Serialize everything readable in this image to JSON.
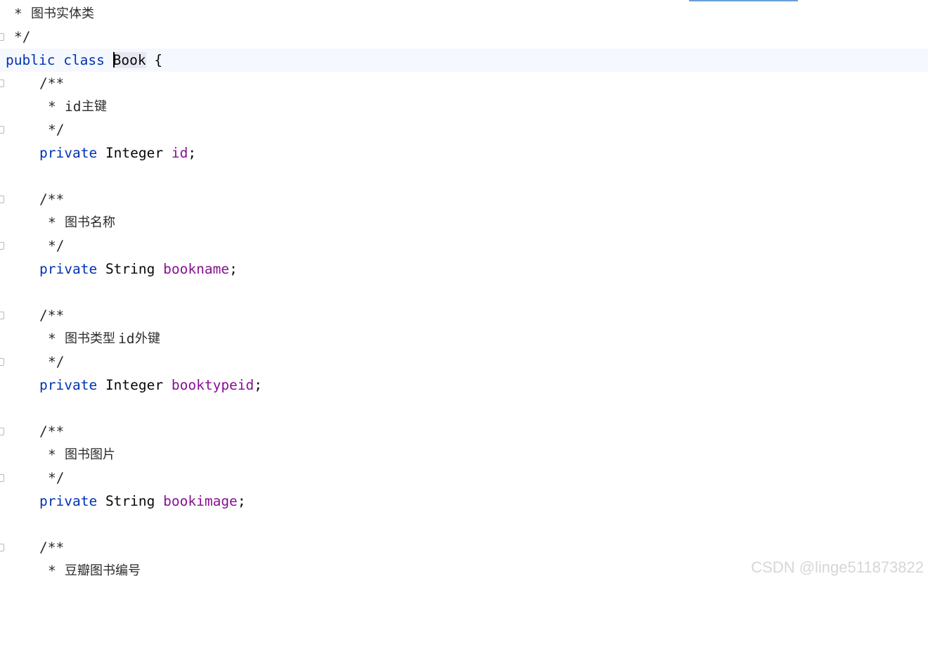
{
  "editor": {
    "language": "Java",
    "colors": {
      "keyword": "#0033b3",
      "field": "#871094",
      "text": "#080808",
      "current_line": "#f5f8fe",
      "watermark": "#c8c8c8"
    },
    "lines": {
      "l1_star": "* ",
      "l1_text": "图书实体类",
      "l2": "*/",
      "l3_kw1": "public",
      "l3_kw2": "class",
      "l3_name": "Book",
      "l3_brace": " {",
      "c_open": "/**",
      "c_close": "*/",
      "c1_id": "id",
      "c1_text": "主键",
      "f1_kw": "private",
      "f1_type": "Integer",
      "f1_name": "id",
      "c2_text": "图书名称",
      "f2_kw": "private",
      "f2_type": "String",
      "f2_name": "bookname",
      "c3_text1": "图书类型",
      "c3_id": "id",
      "c3_text2": "外键",
      "f3_kw": "private",
      "f3_type": "Integer",
      "f3_name": "booktypeid",
      "c4_text": "图书图片",
      "f4_kw": "private",
      "f4_type": "String",
      "f4_name": "bookimage",
      "c5_text": "豆瓣图书编号",
      "semicolon": ";",
      "star": "* "
    }
  },
  "watermark": "CSDN @linge511873822"
}
